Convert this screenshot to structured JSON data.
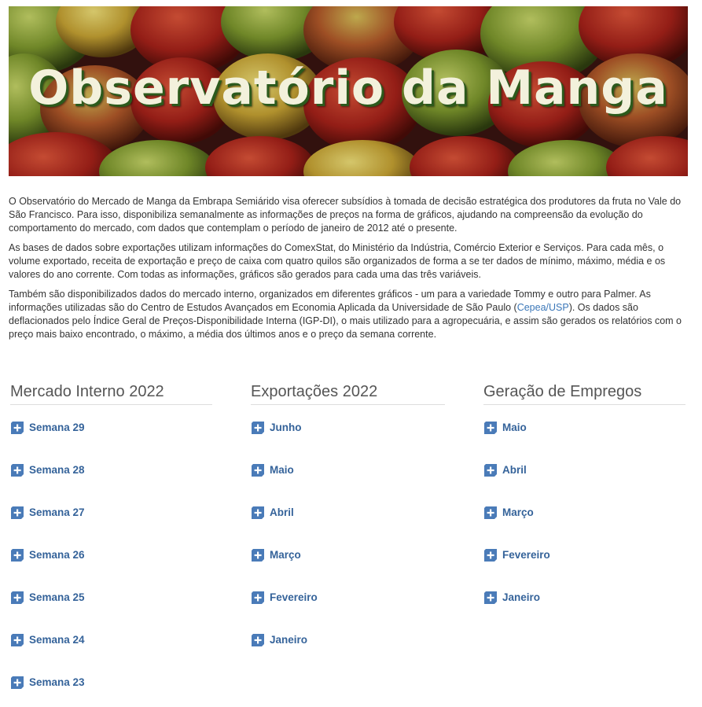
{
  "banner": {
    "title": "Observatório da Manga"
  },
  "intro": {
    "p1": "O Observatório do Mercado de Manga da Embrapa Semiárido visa oferecer subsídios à tomada de decisão estratégica dos produtores da fruta no Vale do São Francisco. Para isso, disponibiliza semanalmente as informações de preços na forma de gráficos, ajudando na compreensão da evolução do comportamento do mercado, com dados que contemplam o período de janeiro de 2012 até o presente.",
    "p2": "As bases de dados sobre exportações utilizam informações do ComexStat, do Ministério da Indústria, Comércio Exterior e Serviços. Para cada mês, o volume exportado, receita de exportação e preço de caixa com quatro quilos são organizados de forma a se ter dados de mínimo, máximo, média e os valores do ano corrente. Com todas as informações, gráficos são gerados para cada uma das três variáveis.",
    "p3_before": "Também são disponibilizados dados do mercado interno, organizados em diferentes gráficos - um para a variedade Tommy e outro para Palmer.  As informações utilizadas são do Centro de Estudos Avançados em Economia Aplicada da Universidade de São Paulo (",
    "p3_link": "Cepea/USP",
    "p3_after": "). Os dados são deflacionados pelo Índice Geral de Preços-Disponibilidade Interna (IGP-DI), o mais utilizado para a agropecuária, e assim são gerados os relatórios com o preço mais baixo encontrado, o máximo, a média dos últimos anos e o preço da semana corrente."
  },
  "columns": [
    {
      "title": "Mercado Interno 2022",
      "items": [
        "Semana 29",
        "Semana 28",
        "Semana 27",
        "Semana 26",
        "Semana 25",
        "Semana 24",
        "Semana 23"
      ]
    },
    {
      "title": "Exportações 2022",
      "items": [
        "Junho",
        "Maio",
        "Abril",
        "Março",
        "Fevereiro",
        "Janeiro"
      ]
    },
    {
      "title": "Geração de Empregos",
      "items": [
        "Maio",
        "Abril",
        "Março",
        "Fevereiro",
        "Janeiro"
      ]
    }
  ],
  "colors": {
    "link": "#35639a",
    "icon": "#4a7bb8",
    "text": "#333333",
    "heading": "#555555",
    "banner_text": "#f3f1dc"
  },
  "icons": {
    "list_item": "plus-icon"
  }
}
